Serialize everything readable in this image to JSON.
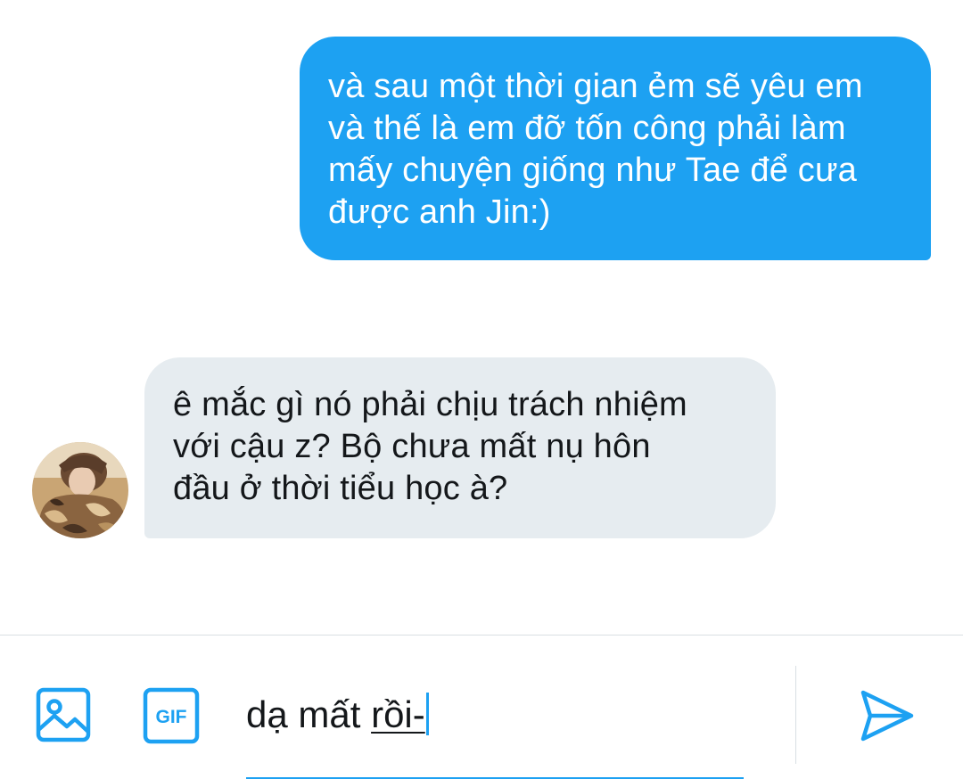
{
  "conversation": {
    "messages": [
      {
        "direction": "sent",
        "text": "và sau một thời gian ẻm sẽ yêu em\nvà thế là em đỡ tốn công phải làm\nmấy chuyện giống như Tae để cưa\nđược anh Jin:)"
      },
      {
        "direction": "received",
        "text": "ê mắc gì nó phải chịu trách nhiệm\nvới cậu z? Bộ chưa mất nụ hôn\nđầu ở thời tiểu học à?"
      }
    ]
  },
  "composer": {
    "input_text": "dạ mất ",
    "composing_text": "rồi-",
    "icons": {
      "image": "image-icon",
      "gif": "gif-icon",
      "gif_label": "GIF",
      "send": "send-icon"
    }
  },
  "colors": {
    "accent": "#1da1f2",
    "received_bubble": "#e6ecf0",
    "text": "#14171a"
  }
}
